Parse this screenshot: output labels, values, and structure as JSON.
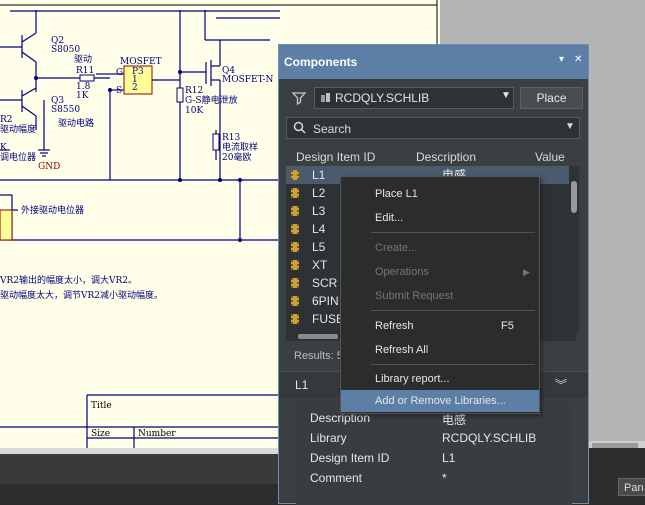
{
  "schematic": {
    "labels": {
      "q2": "Q2",
      "s8050": "S8050",
      "drive": "驱动",
      "r11": "R11",
      "r11_val1": "1.8",
      "r11_val2": "1K",
      "mosfet": "MOSFET",
      "p3": "P3",
      "g": "G",
      "s": "S",
      "p1": "1",
      "p2": "2",
      "q4": "Q4",
      "mosfet_n": "MOSFET-N",
      "r12": "R12",
      "r12_desc": "G-S静电泄放",
      "r12_val": "10K",
      "q3": "Q3",
      "s8550": "S8550",
      "drive_circuit": "驱动电路",
      "r2": "R2",
      "amp": "驱动幅度",
      "k": "K",
      "pot": "调电位器",
      "gnd": "GND",
      "r13": "R13",
      "r13_desc": "电流取样",
      "r13_val": "20毫欧",
      "ext_pot": "外接驱动电位器",
      "note1": "VR2输出的幅度太小，调大VR2。",
      "note2": "驱动幅度太大，调节VR2减小驱动幅度。",
      "title": "Title",
      "size": "Size",
      "number": "Number"
    }
  },
  "panel": {
    "title": "Components",
    "title_icons": [
      "pin-icon",
      "close-icon"
    ],
    "library": "RCDQLY.SCHLIB",
    "place_button": "Place",
    "search_placeholder": "Search",
    "columns": [
      "Design Item ID",
      "Description",
      "Value"
    ],
    "rows": [
      {
        "id": "L1",
        "desc": "电感"
      },
      {
        "id": "L2",
        "desc": ""
      },
      {
        "id": "L3",
        "desc": ""
      },
      {
        "id": "L4",
        "desc": ""
      },
      {
        "id": "L5",
        "desc": ""
      },
      {
        "id": "XT",
        "desc": ""
      },
      {
        "id": "SCR",
        "desc": ""
      },
      {
        "id": "6PIN",
        "desc": ""
      },
      {
        "id": "FUSE",
        "desc": ""
      }
    ],
    "results": "Results: 5",
    "detail_title": "L1",
    "properties": [
      {
        "label": "Description",
        "value": "电感"
      },
      {
        "label": "Library",
        "value": "RCDQLY.SCHLIB"
      },
      {
        "label": "Design Item ID",
        "value": "L1"
      },
      {
        "label": "Comment",
        "value": "*"
      }
    ]
  },
  "context_menu": {
    "place": "Place L1",
    "edit": "Edit...",
    "create": "Create...",
    "operations": "Operations",
    "submit": "Submit Request",
    "refresh": "Refresh",
    "refresh_shortcut": "F5",
    "refresh_all": "Refresh All",
    "library_report": "Library report...",
    "add_remove": "Add or Remove Libraries..."
  },
  "statusbar": {
    "panels_button": "Pan"
  },
  "colors": {
    "accent": "#5d7fa5",
    "panel_bg": "#3c3f41",
    "sheet_bg": "#ffffe9",
    "wire": "#000080"
  }
}
